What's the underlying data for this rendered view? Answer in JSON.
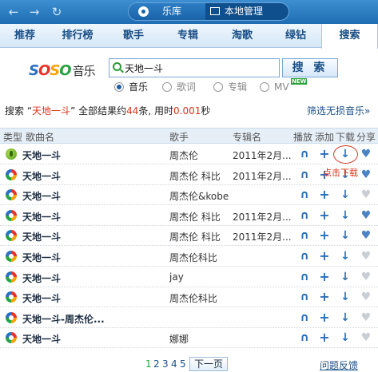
{
  "window": {
    "view_active": "乐库",
    "view_inactive": "本地管理"
  },
  "tabs": [
    {
      "label": "推荐"
    },
    {
      "label": "排行榜"
    },
    {
      "label": "歌手"
    },
    {
      "label": "专辑"
    },
    {
      "label": "淘歌"
    },
    {
      "label": "绿钻"
    },
    {
      "label": "搜索"
    }
  ],
  "active_tab": "搜索",
  "logo": {
    "text": "SOSO",
    "suffix": "音乐"
  },
  "search": {
    "value": "天地一斗",
    "button_label": "搜 索"
  },
  "search_types": [
    {
      "label": "音乐",
      "checked": true
    },
    {
      "label": "歌词",
      "checked": false
    },
    {
      "label": "专辑",
      "checked": false
    },
    {
      "label": "MV",
      "checked": false
    }
  ],
  "new_badge": "NEW",
  "result_summary": {
    "prefix": "搜索 “",
    "query": "天地一斗",
    "mid": "” 全部结果约",
    "count": "44",
    "mid2": "条, 用时",
    "time": "0.001",
    "suffix": "秒"
  },
  "filter_link": "筛选无损音乐»",
  "columns": {
    "type": "类型",
    "song": "歌曲名",
    "singer": "歌手",
    "album": "专辑名",
    "play": "播放",
    "add": "添加",
    "download": "下载",
    "share": "分享"
  },
  "rows": [
    {
      "song": "天地一斗",
      "singer": "周杰伦",
      "album": "2011年2月...",
      "icon": "green-music-icon",
      "share_active": true
    },
    {
      "song": "天地一斗",
      "singer": "周杰伦 科比",
      "album": "2011年2月...",
      "icon": "soso-music-icon",
      "share_active": true
    },
    {
      "song": "天地一斗",
      "singer": "周杰伦&kobe",
      "album": "",
      "icon": "soso-music-icon",
      "share_active": false
    },
    {
      "song": "天地一斗",
      "singer": "周杰伦 科比",
      "album": "2011年2月...",
      "icon": "soso-music-icon",
      "share_active": true
    },
    {
      "song": "天地一斗",
      "singer": "周杰伦 科比",
      "album": "2011年2月...",
      "icon": "soso-music-icon",
      "share_active": true
    },
    {
      "song": "天地一斗",
      "singer": "周杰伦科比",
      "album": "",
      "icon": "soso-music-icon",
      "share_active": false
    },
    {
      "song": "天地一斗",
      "singer": "jay",
      "album": "",
      "icon": "soso-music-icon",
      "share_active": false
    },
    {
      "song": "天地一斗",
      "singer": "周杰伦科比",
      "album": "",
      "icon": "soso-music-icon",
      "share_active": false
    },
    {
      "song": "天地一斗-周杰伦...",
      "singer": "",
      "album": "",
      "icon": "soso-music-icon",
      "share_active": false
    },
    {
      "song": "天地一斗",
      "singer": "娜娜",
      "album": "",
      "icon": "soso-music-icon",
      "share_active": false
    }
  ],
  "annotation": "点击下载",
  "pagination": {
    "pages": [
      "1",
      "2",
      "3",
      "4",
      "5"
    ],
    "current": "1",
    "next_label": "下一页"
  },
  "feedback_link": "问题反馈",
  "colors": {
    "accent": "#1a63a8",
    "highlight": "#d9361b",
    "current_page": "#2aa233"
  }
}
